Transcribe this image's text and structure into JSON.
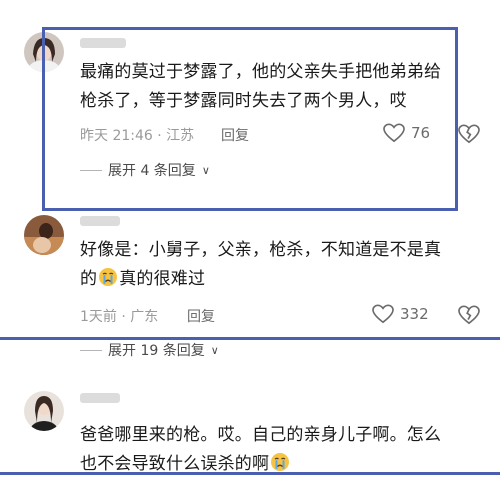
{
  "comments": [
    {
      "text_line1": "最痛的莫过于梦露了，他的父亲失手把他弟弟给",
      "text_line2": "枪杀了，等于梦露同时失去了两个男人，哎",
      "time_location": "昨天 21:46 · 江苏",
      "reply_label": "回复",
      "likes": "76",
      "expand_label": "展开 4 条回复"
    },
    {
      "text_line1": "好像是：小舅子，父亲，枪杀，不知道是不是真",
      "text_line2_before": "的",
      "text_line2_after": "真的很难过",
      "time_location": "1天前 · 广东",
      "reply_label": "回复",
      "likes": "332",
      "expand_label": "展开 19 条回复"
    },
    {
      "text_line1": "爸爸哪里来的枪。哎。自己的亲身儿子啊。怎么",
      "text_line2": "也不会导致什么误杀的啊"
    }
  ],
  "icons": {
    "like": "heart-outline-icon",
    "dislike": "broken-heart-icon",
    "crying_emoji": "crying-face-emoji",
    "expand": "chevron-down-icon"
  },
  "colors": {
    "highlight": "#4b5fb0",
    "meta_gray": "#9a9a9a",
    "emoji_yellow": "#f6c343"
  }
}
